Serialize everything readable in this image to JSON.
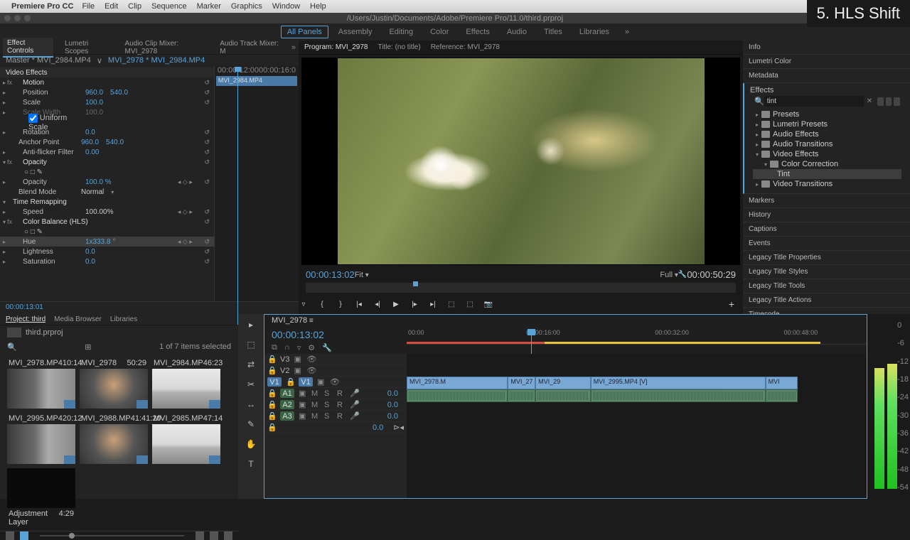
{
  "overlay_title": "5. HLS Shift",
  "mac_menu": {
    "app": "Premiere Pro CC",
    "items": [
      "File",
      "Edit",
      "Clip",
      "Sequence",
      "Marker",
      "Graphics",
      "Window",
      "Help"
    ]
  },
  "doc_path": "/Users/Justin/Documents/Adobe/Premiere Pro/11.0/third.prproj",
  "workspaces": [
    "All Panels",
    "Assembly",
    "Editing",
    "Color",
    "Effects",
    "Audio",
    "Titles",
    "Libraries"
  ],
  "ec": {
    "tabs": [
      "Effect Controls",
      "Lumetri Scopes",
      "Audio Clip Mixer: MVI_2978",
      "Audio Track Mixer: M"
    ],
    "master": "Master * MVI_2984.MP4",
    "clip": "MVI_2978 * MVI_2984.MP4",
    "mini_t1": "00:00:12:00",
    "mini_t2": "00:00:16:0",
    "mini_clip": "MVI_2984.MP4",
    "video_effects": "Video Effects",
    "motion": "Motion",
    "position": "Position",
    "pos_x": "960.0",
    "pos_y": "540.0",
    "scale": "Scale",
    "scale_v": "100.0",
    "scale_width": "Scale Width",
    "scale_w_v": "100.0",
    "uniform": "Uniform Scale",
    "rotation": "Rotation",
    "rot_v": "0.0",
    "anchor": "Anchor Point",
    "anc_x": "960.0",
    "anc_y": "540.0",
    "anti": "Anti-flicker Filter",
    "anti_v": "0.00",
    "opacity": "Opacity",
    "opacity_v": "100.0 %",
    "blend": "Blend Mode",
    "blend_v": "Normal",
    "remap": "Time Remapping",
    "speed": "Speed",
    "speed_v": "100.00%",
    "hls": "Color Balance (HLS)",
    "hue": "Hue",
    "hue_v": "1x333.8 °",
    "light": "Lightness",
    "light_v": "0.0",
    "sat": "Saturation",
    "sat_v": "0.0",
    "tc": "00:00:13:01"
  },
  "program": {
    "tabs": [
      "Program: MVI_2978",
      "Title: (no title)",
      "Reference: MVI_2978"
    ],
    "tc_left": "00:00:13:02",
    "fit": "Fit",
    "full": "Full",
    "tc_right": "00:00:50:29"
  },
  "right": {
    "sections": [
      "Info",
      "Lumetri Color",
      "Metadata",
      "Effects",
      "Markers",
      "History",
      "Captions",
      "Events",
      "Legacy Title Properties",
      "Legacy Title Styles",
      "Legacy Title Tools",
      "Legacy Title Actions",
      "Timecode"
    ],
    "search": "tint",
    "tree": [
      "Presets",
      "Lumetri Presets",
      "Audio Effects",
      "Audio Transitions",
      "Video Effects",
      "Color Correction",
      "Tint",
      "Video Transitions"
    ]
  },
  "project": {
    "tabs": [
      "Project: third",
      "Media Browser",
      "Libraries"
    ],
    "bin": "third.prproj",
    "status": "1 of 7 items selected",
    "items": [
      {
        "name": "MVI_2978.MP4",
        "dur": "10:14"
      },
      {
        "name": "MVI_2978",
        "dur": "50:29"
      },
      {
        "name": "MVI_2984.MP4",
        "dur": "6:23"
      },
      {
        "name": "MVI_2995.MP4",
        "dur": "20:12"
      },
      {
        "name": "MVI_2988.MP4",
        "dur": "1:41:20"
      },
      {
        "name": "MVI_2985.MP4",
        "dur": "7:14"
      },
      {
        "name": "Adjustment Layer",
        "dur": "4:29"
      }
    ]
  },
  "timeline": {
    "seq": "MVI_2978",
    "tc": "00:00:13:02",
    "ticks": [
      "00:00",
      "00:00:16:00",
      "00:00:32:00",
      "00:00:48:00"
    ],
    "v": [
      "V3",
      "V2",
      "V1"
    ],
    "a": [
      "A1",
      "A2",
      "A3"
    ],
    "db": "0.0",
    "db2": "0.0",
    "clips": [
      "MVI_2978.M",
      "MVI_27",
      "MVI_29",
      "MVI_2995.MP4 [V]",
      "MVI"
    ]
  },
  "meters": [
    "0",
    "-6",
    "-12",
    "-18",
    "-24",
    "-30",
    "-36",
    "-42",
    "-48",
    "-54"
  ]
}
